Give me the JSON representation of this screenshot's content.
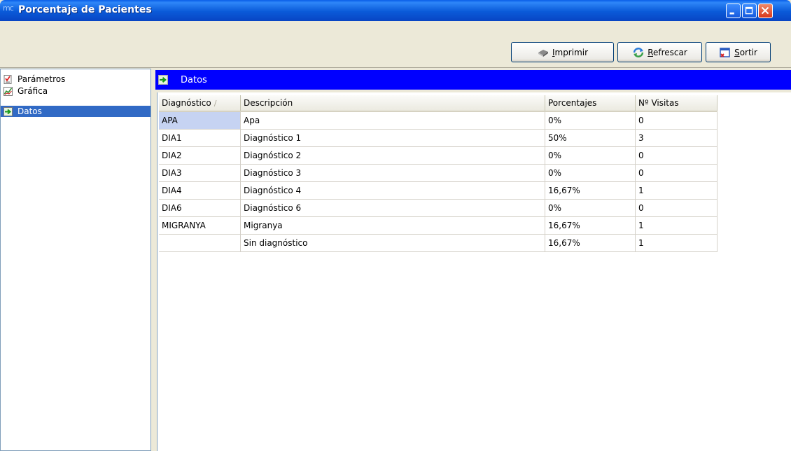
{
  "window": {
    "app_badge": "mc",
    "title": "Porcentaje de Pacientes"
  },
  "toolbar": {
    "print_label_u": "I",
    "print_label_rest": "mprimir",
    "refresh_label_u": "R",
    "refresh_label_rest": "efrescar",
    "exit_label_u": "S",
    "exit_label_rest": "ortir"
  },
  "nav": {
    "items": [
      {
        "label": "Parámetros",
        "icon": "checklist-icon"
      },
      {
        "label": "Gráfica",
        "icon": "chart-icon"
      },
      {
        "label": "Datos",
        "icon": "data-arrow-icon",
        "selected": true
      }
    ]
  },
  "panel": {
    "header": "Datos"
  },
  "table": {
    "columns": [
      "Diagnóstico",
      "Descripción",
      "Porcentajes",
      "Nº Visitas"
    ],
    "sort_indicator": "∕",
    "rows": [
      [
        "APA",
        "Apa",
        "0%",
        "0"
      ],
      [
        "DIA1",
        "Diagnóstico 1",
        "50%",
        "3"
      ],
      [
        "DIA2",
        "Diagnóstico 2",
        "0%",
        "0"
      ],
      [
        "DIA3",
        "Diagnóstico 3",
        "0%",
        "0"
      ],
      [
        "DIA4",
        "Diagnóstico 4",
        "16,67%",
        "1"
      ],
      [
        "DIA6",
        "Diagnóstico 6",
        "0%",
        "0"
      ],
      [
        "MIGRANYA",
        "Migranya",
        "16,67%",
        "1"
      ],
      [
        "",
        "Sin diagnóstico",
        "16,67%",
        "1"
      ]
    ]
  },
  "colors": {
    "titlebar": "#0a5ad8",
    "panel_header": "#0000ff",
    "selection": "#316ac5",
    "focused_cell": "#c6d3f2"
  }
}
